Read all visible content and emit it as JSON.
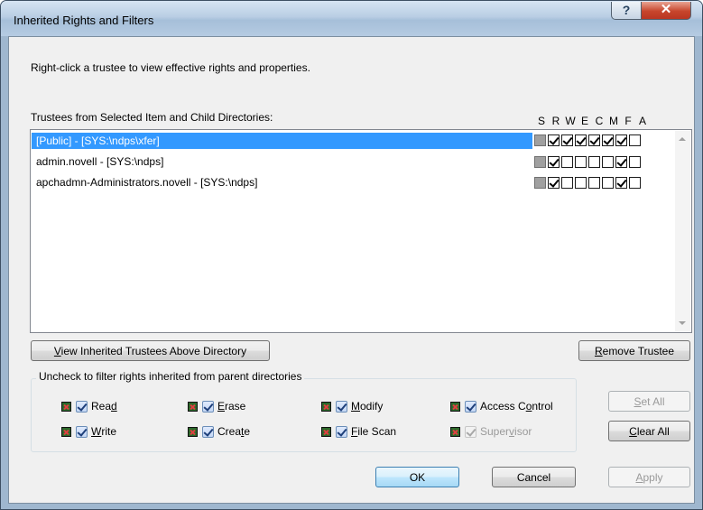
{
  "window": {
    "title": "Inherited Rights and Filters",
    "help_glyph": "?",
    "close_glyph": "✕"
  },
  "instructions": "Right-click a trustee to view effective rights and properties.",
  "trustees": {
    "heading": "Trustees from Selected Item and Child Directories:",
    "rights_columns": [
      "S",
      "R",
      "W",
      "E",
      "C",
      "M",
      "F",
      "A"
    ],
    "rows": [
      {
        "name": "[Public] - [SYS:\\ndps\\xfer]",
        "selected": true,
        "rights": [
          false,
          true,
          true,
          true,
          true,
          true,
          true,
          false
        ]
      },
      {
        "name": "admin.novell - [SYS:\\ndps]",
        "selected": false,
        "rights": [
          false,
          true,
          false,
          false,
          false,
          false,
          true,
          false
        ]
      },
      {
        "name": "apchadmn-Administrators.novell - [SYS:\\ndps]",
        "selected": false,
        "rights": [
          false,
          true,
          false,
          false,
          false,
          false,
          true,
          false
        ]
      }
    ]
  },
  "buttons": {
    "view_inherited": {
      "pre": "",
      "mn": "V",
      "post": "iew Inherited Trustees Above Directory"
    },
    "remove_trustee": {
      "pre": "",
      "mn": "R",
      "post": "emove Trustee"
    },
    "set_all": {
      "pre": "",
      "mn": "S",
      "post": "et All"
    },
    "clear_all": {
      "pre": "",
      "mn": "C",
      "post": "lear All"
    },
    "ok": "OK",
    "cancel": "Cancel",
    "apply": {
      "pre": "",
      "mn": "A",
      "post": "pply"
    }
  },
  "filters": {
    "group_title": "Uncheck to filter rights inherited from parent directories",
    "items": [
      {
        "pre": "Rea",
        "mn": "d",
        "post": "",
        "checked": true,
        "enabled": true
      },
      {
        "pre": "",
        "mn": "E",
        "post": "rase",
        "checked": true,
        "enabled": true
      },
      {
        "pre": "",
        "mn": "M",
        "post": "odify",
        "checked": true,
        "enabled": true
      },
      {
        "pre": "Access C",
        "mn": "o",
        "post": "ntrol",
        "checked": true,
        "enabled": true
      },
      {
        "pre": "",
        "mn": "W",
        "post": "rite",
        "checked": true,
        "enabled": true
      },
      {
        "pre": "Crea",
        "mn": "t",
        "post": "e",
        "checked": true,
        "enabled": true
      },
      {
        "pre": "",
        "mn": "F",
        "post": "ile Scan",
        "checked": true,
        "enabled": true
      },
      {
        "pre": "Super",
        "mn": "v",
        "post": "isor",
        "checked": true,
        "enabled": false
      }
    ]
  }
}
